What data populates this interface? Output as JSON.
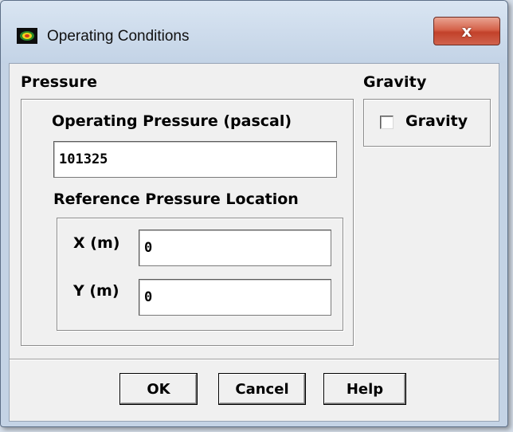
{
  "window": {
    "title": "Operating Conditions",
    "close_glyph": "x",
    "colors": {
      "close_button": "#c94a33",
      "titlebar": "#c3d3e6",
      "client": "#f0f0f0"
    }
  },
  "pressure_group": {
    "title": "Pressure",
    "operating_pressure_label": "Operating Pressure (pascal)",
    "operating_pressure_value": "101325",
    "reference_location": {
      "title": "Reference Pressure Location",
      "x_label": "X (m)",
      "x_value": "0",
      "y_label": "Y (m)",
      "y_value": "0"
    }
  },
  "gravity_group": {
    "title": "Gravity",
    "checkbox_label": "Gravity",
    "checked": false
  },
  "buttons": {
    "ok": "OK",
    "cancel": "Cancel",
    "help": "Help"
  },
  "icons": {
    "app": "fluent-app-icon"
  }
}
